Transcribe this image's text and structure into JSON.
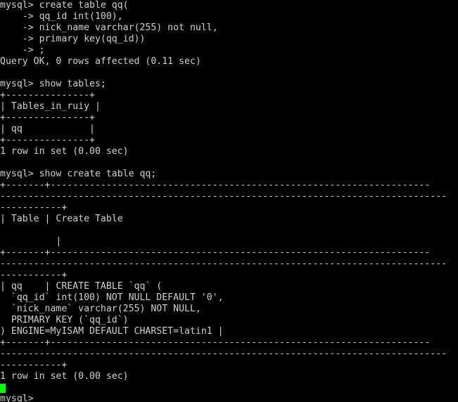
{
  "terminal": {
    "app": "mysql-client-terminal",
    "colors": {
      "background": "#000000",
      "foreground": "#d0d0d0",
      "cursor": "#00ff00"
    },
    "columns": 81,
    "prompt": "mysql>",
    "continuation_prompt": "->",
    "lines": [
      "mysql> create table qq(",
      "    -> qq_id int(100),",
      "    -> nick_name varchar(255) not null,",
      "    -> primary key(qq_id))",
      "    -> ;",
      "Query OK, 0 rows affected (0.11 sec)",
      "",
      "mysql> show tables;",
      "+---------------+",
      "| Tables_in_ruiy |",
      "+---------------+",
      "| qq            |",
      "+---------------+",
      "1 row in set (0.00 sec)",
      "",
      "mysql> show create table qq;",
      "+-------+--------------------------------------------------------------------",
      "--------------------------------------------------------------------------------",
      "-----------+",
      "| Table | Create Table",
      "",
      "          |",
      "+-------+--------------------------------------------------------------------",
      "--------------------------------------------------------------------------------",
      "-----------+",
      "| qq    | CREATE TABLE `qq` (",
      "  `qq_id` int(100) NOT NULL DEFAULT '0',",
      "  `nick_name` varchar(255) NOT NULL,",
      "  PRIMARY KEY (`qq_id`)",
      ") ENGINE=MyISAM DEFAULT CHARSET=latin1 |",
      "+-------+--------------------------------------------------------------------",
      "--------------------------------------------------------------------------------",
      "-----------+",
      "1 row in set (0.00 sec)",
      "",
      "mysql> "
    ],
    "cursor_line_index": 34
  },
  "session": {
    "database_name": "ruiy",
    "table_name": "qq",
    "statements": [
      "create table qq( qq_id int(100), nick_name varchar(255) not null, primary key(qq_id));",
      "show tables;",
      "show create table qq;"
    ],
    "results": [
      "Query OK, 0 rows affected (0.11 sec)",
      "1 row in set (0.00 sec)",
      "1 row in set (0.00 sec)"
    ],
    "tables_column_header": "Tables_in_ruiy",
    "tables_rows": [
      "qq"
    ],
    "create_table_columns": [
      "Table",
      "Create Table"
    ],
    "create_table_ddl": [
      "CREATE TABLE `qq` (",
      "  `qq_id` int(100) NOT NULL DEFAULT '0',",
      "  `nick_name` varchar(255) NOT NULL,",
      "  PRIMARY KEY (`qq_id`)",
      ") ENGINE=MyISAM DEFAULT CHARSET=latin1"
    ]
  }
}
